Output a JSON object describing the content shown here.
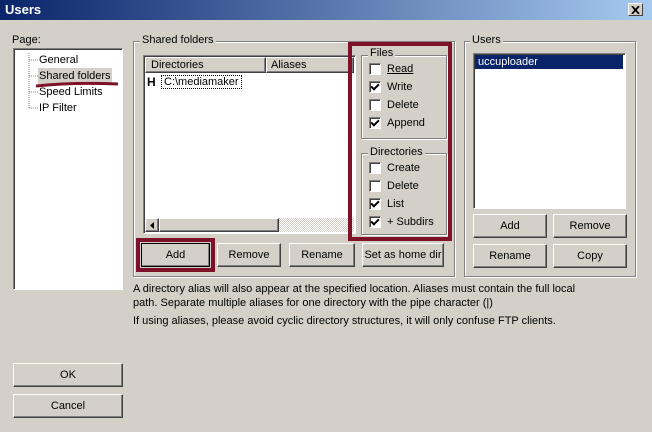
{
  "window": {
    "title": "Users",
    "close_glyph": "✕"
  },
  "page_panel": {
    "label": "Page:",
    "items": [
      "General",
      "Shared folders",
      "Speed Limits",
      "IP Filter"
    ],
    "selected": "Shared folders"
  },
  "shared": {
    "group_label": "Shared folders",
    "col_directories": "Directories",
    "col_aliases": "Aliases",
    "row_marker": "H",
    "row_path": "C:\\mediamaker",
    "buttons": {
      "add": "Add",
      "remove": "Remove",
      "rename": "Rename",
      "home": "Set as home dir"
    }
  },
  "files": {
    "label": "Files",
    "items": [
      {
        "label": "Read",
        "checked": false
      },
      {
        "label": "Write",
        "checked": true
      },
      {
        "label": "Delete",
        "checked": false
      },
      {
        "label": "Append",
        "checked": true
      }
    ]
  },
  "directories": {
    "label": "Directories",
    "items": [
      {
        "label": "Create",
        "checked": false
      },
      {
        "label": "Delete",
        "checked": false
      },
      {
        "label": "List",
        "checked": true
      },
      {
        "label": "+ Subdirs",
        "checked": true
      }
    ]
  },
  "users": {
    "label": "Users",
    "list": [
      "uccuploader"
    ],
    "buttons": {
      "add": "Add",
      "remove": "Remove",
      "rename": "Rename",
      "copy": "Copy"
    }
  },
  "notes": {
    "line1": "A directory alias will also appear at the specified location. Aliases must contain the full local",
    "line2": "path. Separate multiple aliases for one directory with the pipe character (|)",
    "line3": "If using aliases, please avoid cyclic directory structures, it will only confuse FTP clients."
  },
  "footer": {
    "ok": "OK",
    "cancel": "Cancel"
  },
  "colors": {
    "highlight": "#7d1128",
    "selection": "#0a246a",
    "titlebar": "#0a246a",
    "face": "#d4d0c8"
  }
}
